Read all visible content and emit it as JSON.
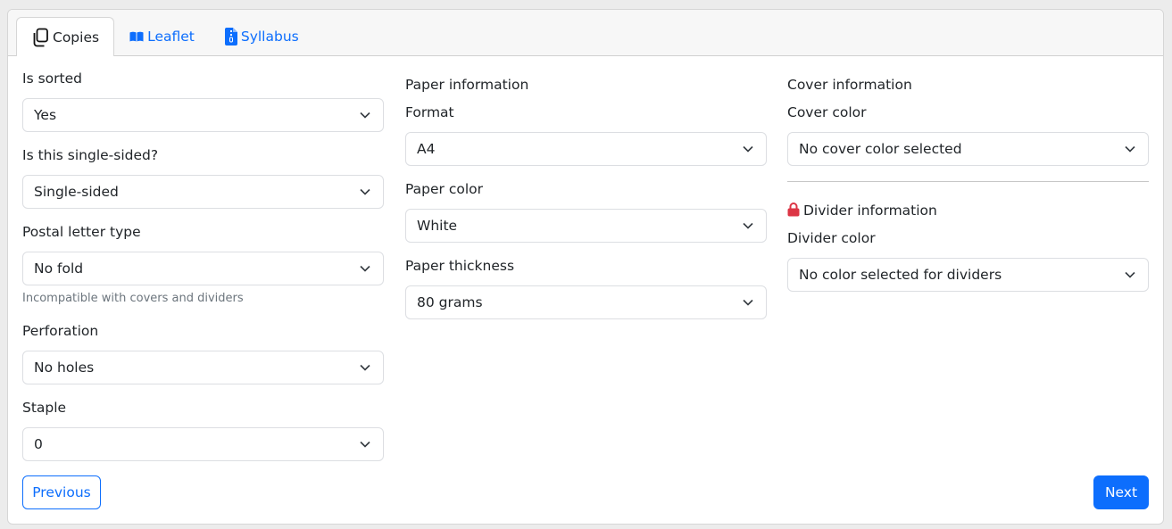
{
  "tabs": [
    {
      "label": "Copies",
      "icon": "copy-icon",
      "active": true
    },
    {
      "label": "Leaflet",
      "icon": "book-icon",
      "active": false
    },
    {
      "label": "Syllabus",
      "icon": "file-zip-icon",
      "active": false
    }
  ],
  "column1": {
    "is_sorted": {
      "label": "Is sorted",
      "value": "Yes"
    },
    "single_sided": {
      "label": "Is this single-sided?",
      "value": "Single-sided"
    },
    "postal_letter": {
      "label": "Postal letter type",
      "value": "No fold",
      "help": "Incompatible with covers and dividers"
    },
    "perforation": {
      "label": "Perforation",
      "value": "No holes"
    },
    "staple": {
      "label": "Staple",
      "value": "0"
    }
  },
  "column2": {
    "section_title": "Paper information",
    "format": {
      "label": "Format",
      "value": "A4"
    },
    "paper_color": {
      "label": "Paper color",
      "value": "White"
    },
    "paper_thickness": {
      "label": "Paper thickness",
      "value": "80 grams"
    }
  },
  "column3": {
    "cover_section_title": "Cover information",
    "cover_color": {
      "label": "Cover color",
      "value": "No cover color selected"
    },
    "divider_section_title": "Divider information",
    "divider_color": {
      "label": "Divider color",
      "value": "No color selected for dividers"
    }
  },
  "buttons": {
    "previous": "Previous",
    "next": "Next"
  },
  "colors": {
    "primary": "#0d6efd",
    "lock": "#dc3545",
    "text": "#212529",
    "muted": "#6c757d"
  }
}
